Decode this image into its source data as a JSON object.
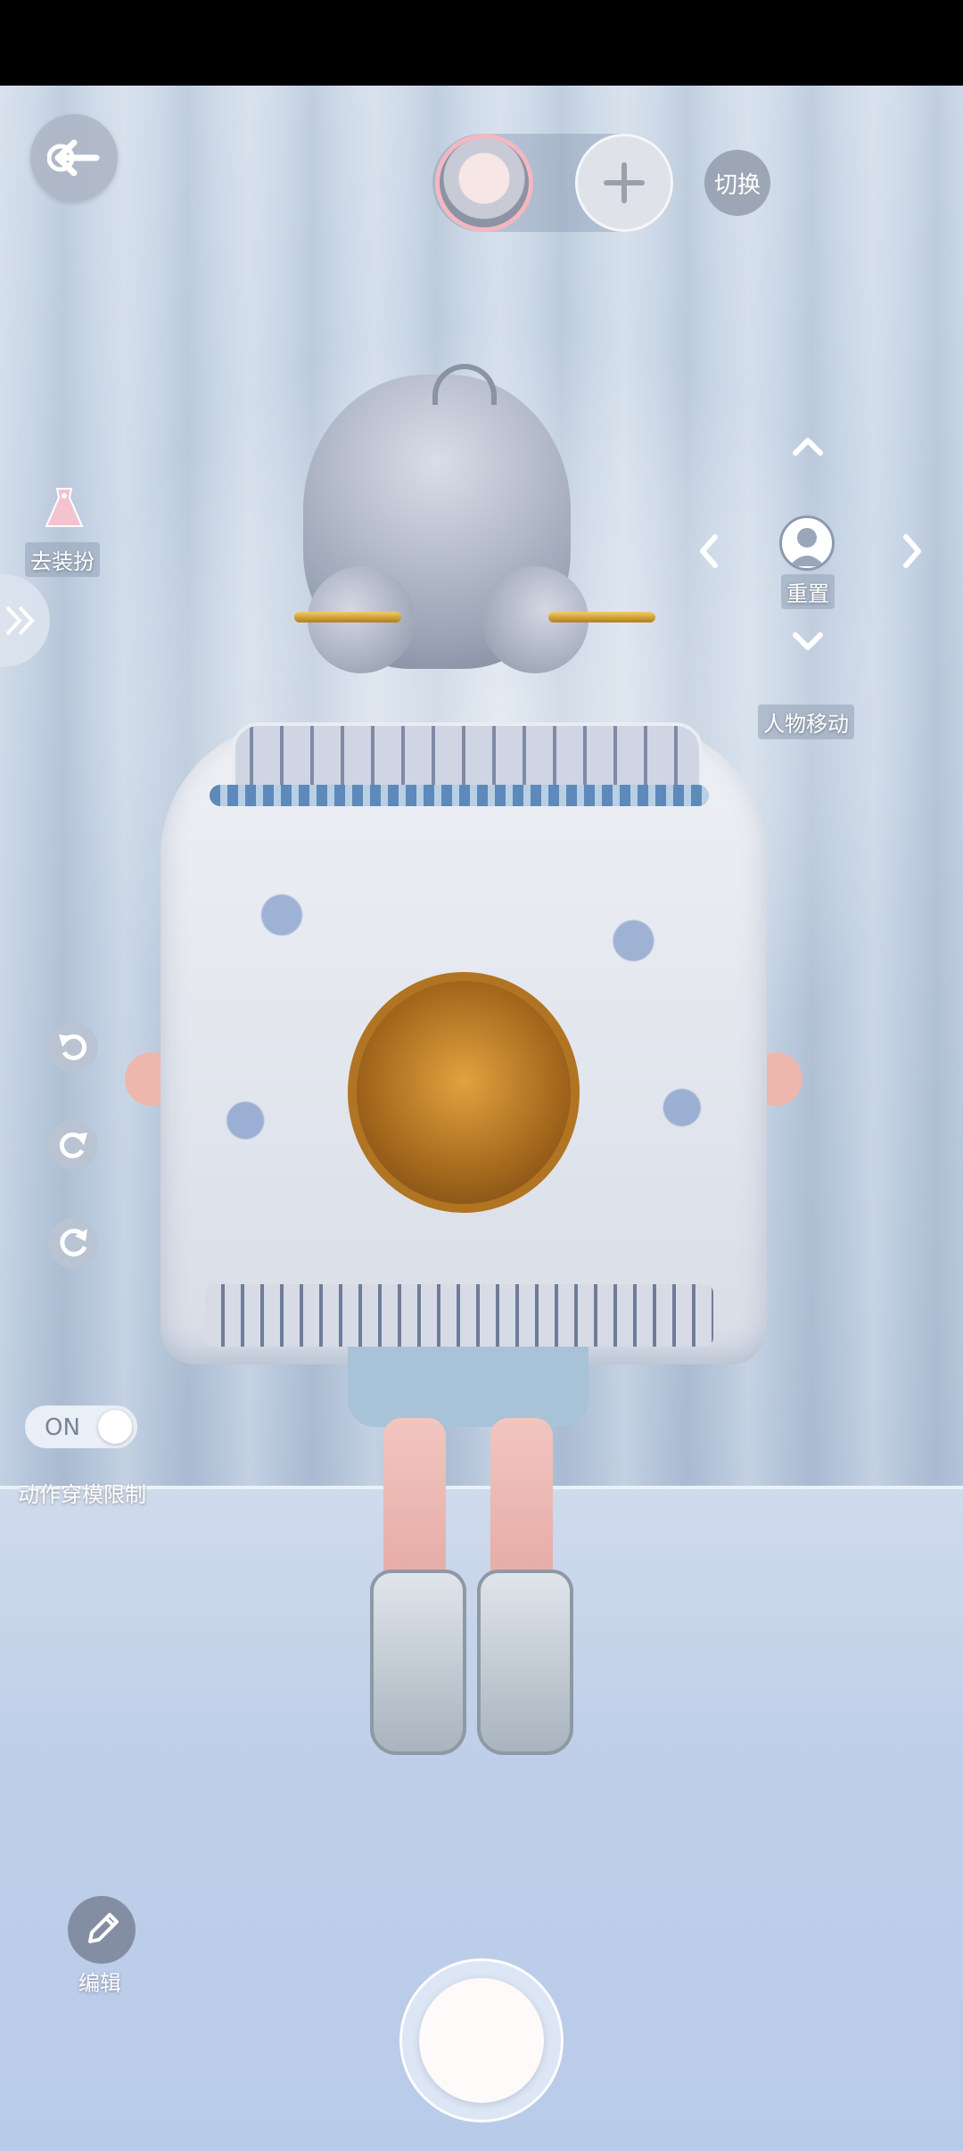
{
  "topbar": {
    "switch_label": "切换"
  },
  "left_panel": {
    "dress_label": "去装扮",
    "collision_toggle": {
      "state": "ON",
      "label": "动作穿模限制"
    },
    "edit_label": "编辑"
  },
  "movement": {
    "reset_label": "重置",
    "title": "人物移动"
  },
  "colors": {
    "avatar_ring": "#f4b7c1",
    "dress_icon": "#f3c3d0",
    "button_gray": "#aab4c3"
  },
  "icons": {
    "back": "back-arrow-icon",
    "add": "plus-icon",
    "undo": "undo-icon",
    "redo": "redo-icon",
    "refresh": "refresh-icon",
    "edit": "pencil-icon"
  }
}
